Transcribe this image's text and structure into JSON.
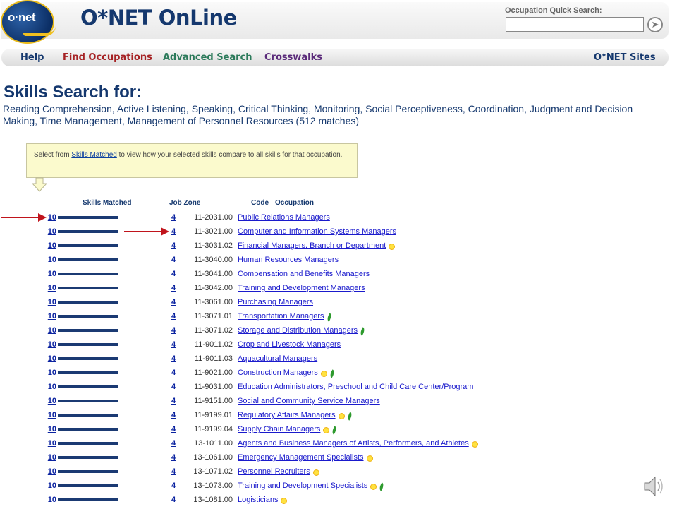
{
  "header": {
    "logo_text": "o·net",
    "app_title": "O*NET OnLine",
    "quick_search_label": "Occupation Quick Search:",
    "quick_search_value": "",
    "go_icon": "go-arrow-icon"
  },
  "nav": {
    "help": "Help",
    "find_occupations": "Find Occupations",
    "advanced_search": "Advanced Search",
    "crosswalks": "Crosswalks",
    "onet_sites": "O*NET Sites",
    "colors": {
      "help": "#15386e",
      "find_occupations": "#a62224",
      "advanced_search": "#2b7a5a",
      "crosswalks": "#5a2a7a",
      "onet_sites": "#15386e"
    }
  },
  "page": {
    "title": "Skills Search for:",
    "skills_text": "Reading Comprehension, Active Listening, Speaking, Critical Thinking, Monitoring, Social Perceptiveness, Coordination, Judgment and Decision Making, Time Management, Management of Personnel Resources (512 matches)"
  },
  "tip": {
    "before": "Select from ",
    "link": "Skills Matched",
    "after": " to view how your selected skills compare to all skills for that occupation."
  },
  "table": {
    "headers": {
      "skills_matched": "Skills Matched",
      "job_zone": "Job Zone",
      "code": "Code",
      "occupation": "Occupation"
    },
    "rows": [
      {
        "score": "10",
        "zone": "4",
        "code": "11-2031.00",
        "occupation": "Public Relations Managers",
        "bright": false,
        "green": false
      },
      {
        "score": "10",
        "zone": "4",
        "code": "11-3021.00",
        "occupation": "Computer and Information Systems Managers",
        "bright": false,
        "green": false
      },
      {
        "score": "10",
        "zone": "4",
        "code": "11-3031.02",
        "occupation": "Financial Managers, Branch or Department",
        "bright": true,
        "green": false
      },
      {
        "score": "10",
        "zone": "4",
        "code": "11-3040.00",
        "occupation": "Human Resources Managers",
        "bright": false,
        "green": false
      },
      {
        "score": "10",
        "zone": "4",
        "code": "11-3041.00",
        "occupation": "Compensation and Benefits Managers",
        "bright": false,
        "green": false
      },
      {
        "score": "10",
        "zone": "4",
        "code": "11-3042.00",
        "occupation": "Training and Development Managers",
        "bright": false,
        "green": false
      },
      {
        "score": "10",
        "zone": "4",
        "code": "11-3061.00",
        "occupation": "Purchasing Managers",
        "bright": false,
        "green": false
      },
      {
        "score": "10",
        "zone": "4",
        "code": "11-3071.01",
        "occupation": "Transportation Managers",
        "bright": false,
        "green": true
      },
      {
        "score": "10",
        "zone": "4",
        "code": "11-3071.02",
        "occupation": "Storage and Distribution Managers",
        "bright": false,
        "green": true
      },
      {
        "score": "10",
        "zone": "4",
        "code": "11-9011.02",
        "occupation": "Crop and Livestock Managers",
        "bright": false,
        "green": false
      },
      {
        "score": "10",
        "zone": "4",
        "code": "11-9011.03",
        "occupation": "Aquacultural Managers",
        "bright": false,
        "green": false
      },
      {
        "score": "10",
        "zone": "4",
        "code": "11-9021.00",
        "occupation": "Construction Managers",
        "bright": true,
        "green": true
      },
      {
        "score": "10",
        "zone": "4",
        "code": "11-9031.00",
        "occupation": "Education Administrators, Preschool and Child Care Center/Program",
        "bright": false,
        "green": false
      },
      {
        "score": "10",
        "zone": "4",
        "code": "11-9151.00",
        "occupation": "Social and Community Service Managers",
        "bright": false,
        "green": false
      },
      {
        "score": "10",
        "zone": "4",
        "code": "11-9199.01",
        "occupation": "Regulatory Affairs Managers",
        "bright": true,
        "green": true
      },
      {
        "score": "10",
        "zone": "4",
        "code": "11-9199.04",
        "occupation": "Supply Chain Managers",
        "bright": true,
        "green": true
      },
      {
        "score": "10",
        "zone": "4",
        "code": "13-1011.00",
        "occupation": "Agents and Business Managers of Artists, Performers, and Athletes",
        "bright": true,
        "green": false
      },
      {
        "score": "10",
        "zone": "4",
        "code": "13-1061.00",
        "occupation": "Emergency Management Specialists",
        "bright": true,
        "green": false
      },
      {
        "score": "10",
        "zone": "4",
        "code": "13-1071.02",
        "occupation": "Personnel Recruiters",
        "bright": true,
        "green": false
      },
      {
        "score": "10",
        "zone": "4",
        "code": "13-1073.00",
        "occupation": "Training and Development Specialists",
        "bright": true,
        "green": true
      },
      {
        "score": "10",
        "zone": "4",
        "code": "13-1081.00",
        "occupation": "Logisticians",
        "bright": true,
        "green": false
      }
    ]
  },
  "annotations": {
    "arrow_color": "#c0141c"
  },
  "speaker_icon": "speaker-icon"
}
